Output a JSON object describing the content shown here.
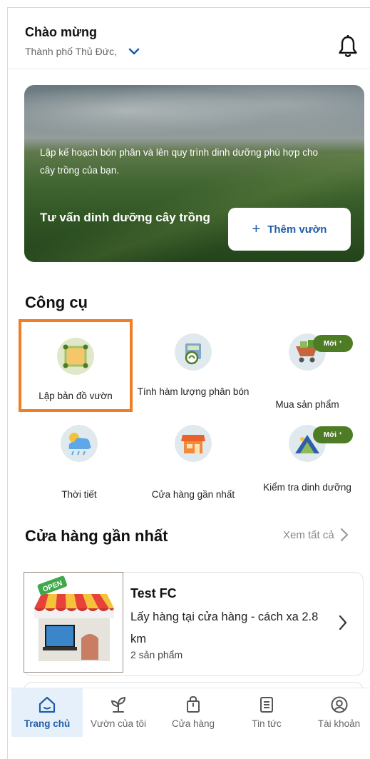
{
  "header": {
    "greeting": "Chào mừng",
    "location": "Thành phố Thủ Đức,",
    "chevron_icon": "chevron-down-icon",
    "bell_icon": "bell-icon"
  },
  "banner": {
    "description": "Lập kế hoạch bón phân và lên quy trình dinh dưỡng phù hợp cho cây trồng của bạn.",
    "title": "Tư vấn dinh dưỡng cây trồng",
    "add_button_plus": "+",
    "add_button_label": "Thêm vườn"
  },
  "tools": {
    "title": "Công cụ",
    "new_badge": "Mới ⁺",
    "items": [
      {
        "label": "Lập bản đồ vườn",
        "icon": "map-icon",
        "highlighted": true
      },
      {
        "label": "Tính hàm lượng phân bón",
        "icon": "fertilizer-calc-icon"
      },
      {
        "label": "Mua sản phẩm",
        "icon": "cart-icon",
        "badge": true
      },
      {
        "label": "Thời tiết",
        "icon": "weather-icon"
      },
      {
        "label": "Cửa hàng gần nhất",
        "icon": "store-icon"
      },
      {
        "label": "Kiểm tra dinh dưỡng",
        "icon": "nutrition-check-icon",
        "badge": true
      }
    ]
  },
  "nearby": {
    "title": "Cửa hàng gần nhất",
    "see_all": "Xem tất cả",
    "store": {
      "name": "Test FC",
      "description": "Lấy hàng tại cửa hàng - cách xa 2.8 km",
      "count": "2 sản phẩm",
      "sign": "OPEN"
    }
  },
  "bottom_nav": [
    {
      "label": "Trang chủ",
      "icon": "home-icon",
      "active": true
    },
    {
      "label": "Vườn của tôi",
      "icon": "plant-icon"
    },
    {
      "label": "Cửa hàng",
      "icon": "shopping-bag-icon"
    },
    {
      "label": "Tin tức",
      "icon": "news-icon"
    },
    {
      "label": "Tài khoản",
      "icon": "account-icon"
    }
  ],
  "colors": {
    "accent": "#1f5ea8",
    "highlight_border": "#f07e26",
    "badge": "#4e7c25"
  }
}
